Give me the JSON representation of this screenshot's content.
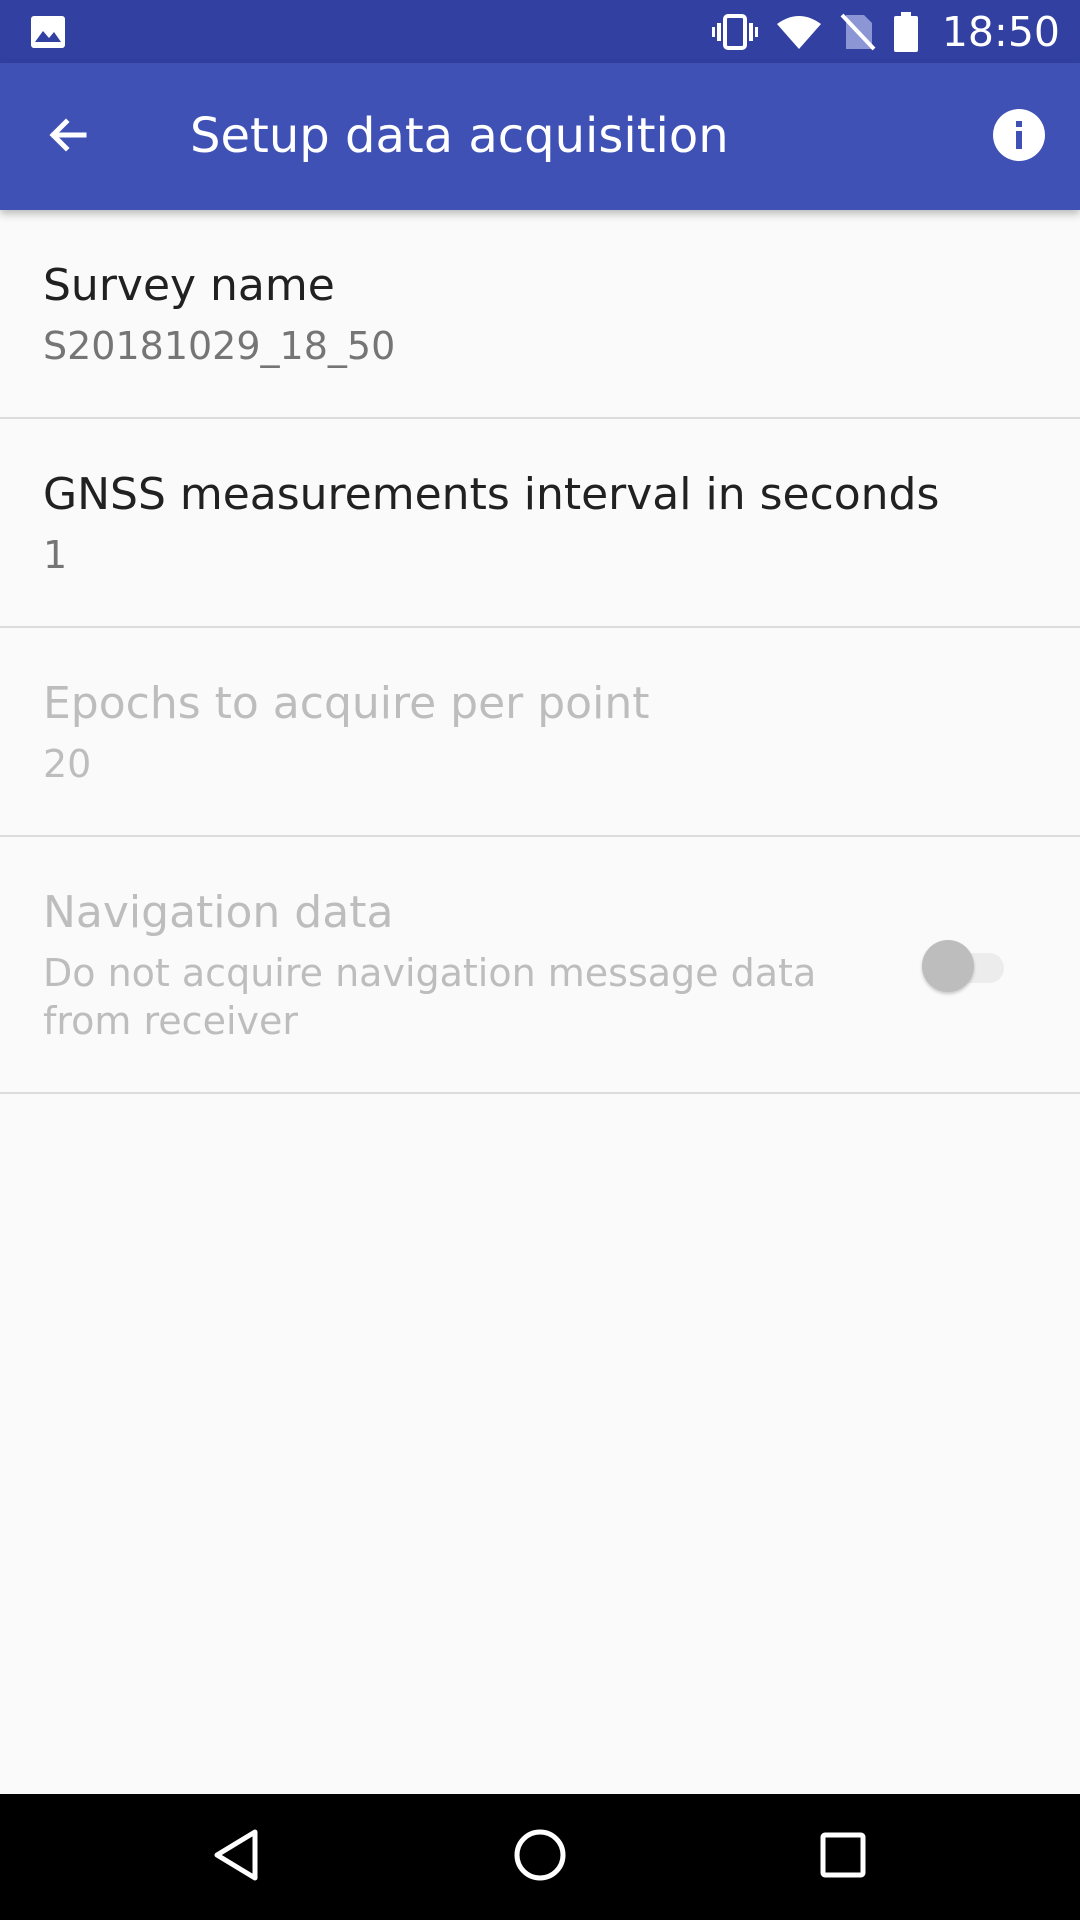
{
  "status_bar": {
    "time": "18:50",
    "icons": [
      "image-icon",
      "vibrate-icon",
      "wifi-icon",
      "no-sim-icon",
      "battery-icon"
    ]
  },
  "app_bar": {
    "title": "Setup data acquisition",
    "back_icon": "arrow-back-icon",
    "info_icon": "info-icon",
    "background": "#3f51b5",
    "status_background": "#3140a1"
  },
  "preferences": [
    {
      "title": "Survey name",
      "summary": "S20181029_18_50",
      "enabled": true
    },
    {
      "title": "GNSS measurements interval in seconds",
      "summary": "1",
      "enabled": true
    },
    {
      "title": "Epochs to acquire per point",
      "summary": "20",
      "enabled": false
    },
    {
      "title": "Navigation data",
      "summary_line1": "Do not acquire navigation message data",
      "summary_line2": "from receiver",
      "enabled": false,
      "switch_on": false
    }
  ],
  "nav_bar": {
    "buttons": [
      "back-triangle-icon",
      "home-circle-icon",
      "recents-square-icon"
    ]
  }
}
